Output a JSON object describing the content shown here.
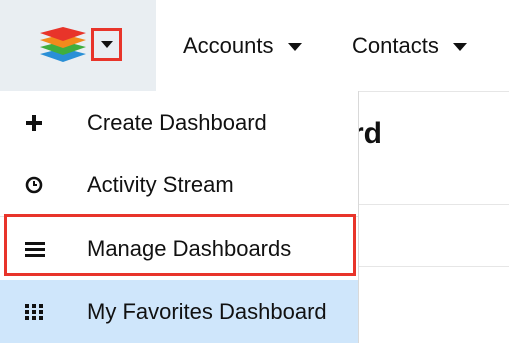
{
  "nav": {
    "items": [
      {
        "label": "Accounts"
      },
      {
        "label": "Contacts"
      }
    ]
  },
  "background": {
    "title_fragment": "rd",
    "text_fragment": "/"
  },
  "menu": {
    "items": [
      {
        "label": "Create Dashboard",
        "icon": "plus-icon"
      },
      {
        "label": "Activity Stream",
        "icon": "clock-icon"
      },
      {
        "label": "Manage Dashboards",
        "icon": "menu-lines-icon"
      },
      {
        "label": "My Favorites Dashboard",
        "icon": "grid-icon"
      }
    ]
  },
  "colors": {
    "highlight": "#e8342a",
    "selected_bg": "#cfe6fb",
    "logo_area_bg": "#e9eef2"
  }
}
